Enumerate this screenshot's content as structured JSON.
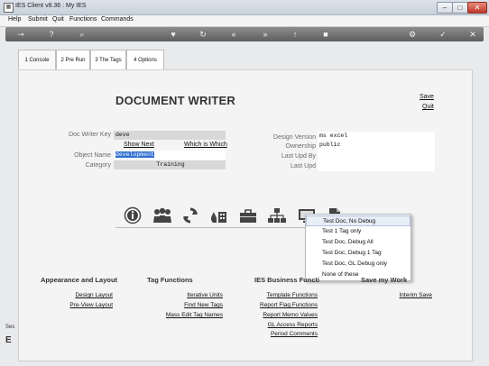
{
  "window": {
    "title": "IES Client v8.36 : My IES",
    "app_icon": "IES"
  },
  "menu": [
    "Help",
    "Submit",
    "Quit",
    "Functions",
    "Commands"
  ],
  "toolbar_icons": [
    "key-icon",
    "help-icon",
    "search-icon",
    "heart-icon",
    "refresh-icon",
    "rewind-icon",
    "fast-forward-icon",
    "up-arrow-icon",
    "stop-icon",
    "settings-icon",
    "check-icon",
    "close-icon"
  ],
  "tabs": [
    {
      "label": "1 Console"
    },
    {
      "label": "2 Pre Run"
    },
    {
      "label": "3 The Tags"
    },
    {
      "label": "4 Options"
    }
  ],
  "page": {
    "title": "DOCUMENT WRITER",
    "save": "Save",
    "quit": "Quit"
  },
  "form": {
    "doc_writer_key_label": "Doc Writer Key",
    "doc_writer_key_value": "deve",
    "show_next": "Show Next",
    "which_is_which": "Which is Which",
    "object_name_label": "Object Name",
    "object_name_value": "development",
    "category_label": "Category",
    "category_value": "Training",
    "design_version_label": "Design Version",
    "design_version_value": "ms excel",
    "ownership_label": "Ownership",
    "ownership_value": "public",
    "last_upd_by_label": "Last Upd By",
    "last_upd_by_value": "",
    "last_upd_label": "Last Upd",
    "last_upd_value": ""
  },
  "dropdown": {
    "items": [
      "Test Doc, No Debug",
      "Test 1 Tag only",
      "Test Doc, Debug All",
      "Test Doc, Debug 1 Tag",
      "Test Doc, GL Debug only",
      "None of these"
    ]
  },
  "sections": {
    "appearance": {
      "title": "Appearance and Layout",
      "links": [
        "Design Layout",
        "Pre-View Layout"
      ]
    },
    "tags": {
      "title": "Tag Functions",
      "links": [
        "Iterative Units",
        "Find New Tags",
        "Mass Edit Tag Names"
      ]
    },
    "business": {
      "title": "IES Business Functi",
      "links": [
        "Template Functions",
        "Report Flag Functions",
        "Report Memo Values",
        "GL Access Reports",
        "Period Comments"
      ]
    },
    "save_work": {
      "title": "Save my Work",
      "links": [
        "Interim Save"
      ]
    }
  },
  "left_edge_fragment": {
    "top": "Ses",
    "bottom": "E"
  }
}
